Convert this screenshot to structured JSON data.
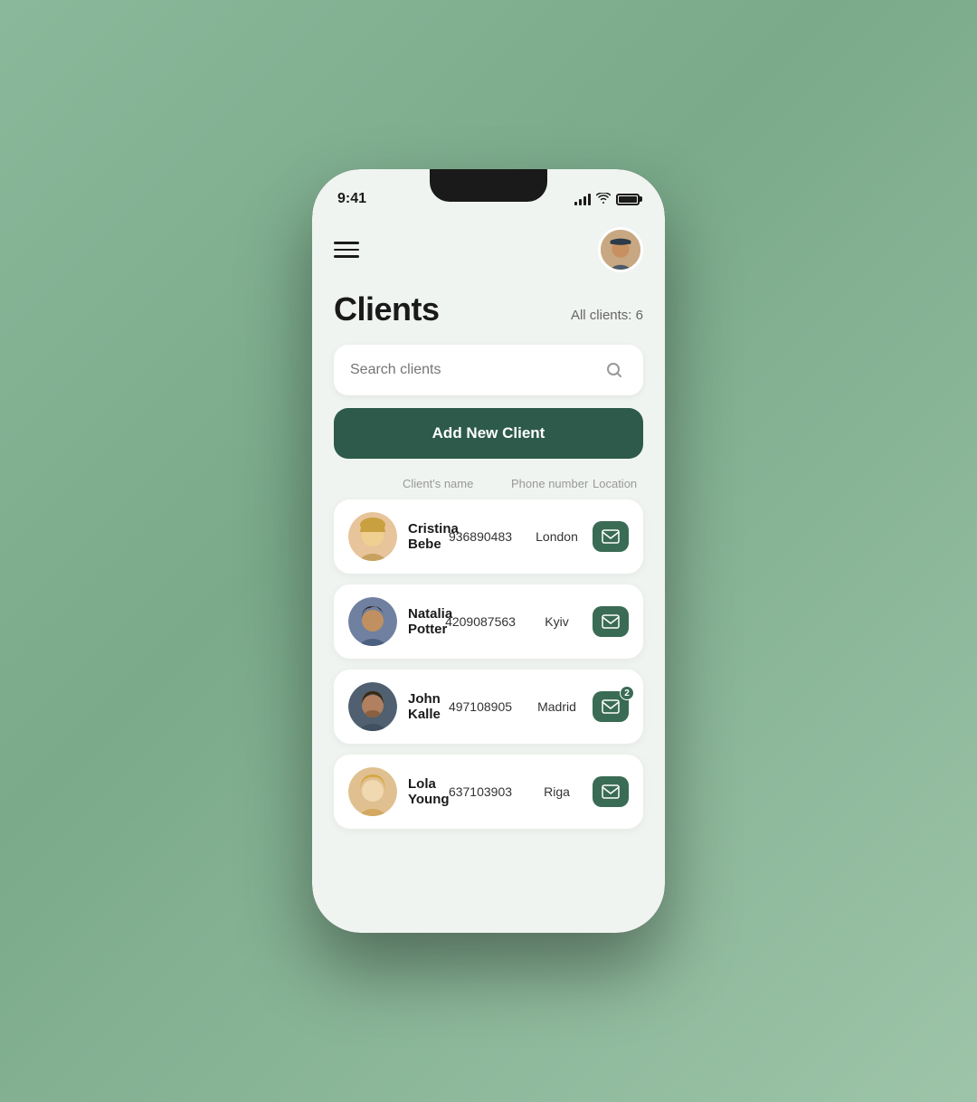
{
  "app": {
    "title": "Clients",
    "all_clients_label": "All clients: 6"
  },
  "status_bar": {
    "time": "9:41"
  },
  "search": {
    "placeholder": "Search clients"
  },
  "add_button": {
    "label": "Add New Client"
  },
  "table": {
    "headers": {
      "name": "Client's name",
      "phone": "Phone number",
      "location": "Location"
    }
  },
  "clients": [
    {
      "id": 1,
      "name": "Cristina Bebe",
      "phone": "936890483",
      "location": "London",
      "avatar_color": "#e8c49a",
      "has_badge": false,
      "badge_count": 0
    },
    {
      "id": 2,
      "name": "Natalia Potter",
      "phone": "4209087563",
      "location": "Kyiv",
      "avatar_color": "#7080a0",
      "has_badge": false,
      "badge_count": 0
    },
    {
      "id": 3,
      "name": "John Kalle",
      "phone": "497108905",
      "location": "Madrid",
      "avatar_color": "#506070",
      "has_badge": true,
      "badge_count": 2
    },
    {
      "id": 4,
      "name": "Lola Young",
      "phone": "637103903",
      "location": "Riga",
      "avatar_color": "#d4a870",
      "has_badge": false,
      "badge_count": 0
    }
  ]
}
